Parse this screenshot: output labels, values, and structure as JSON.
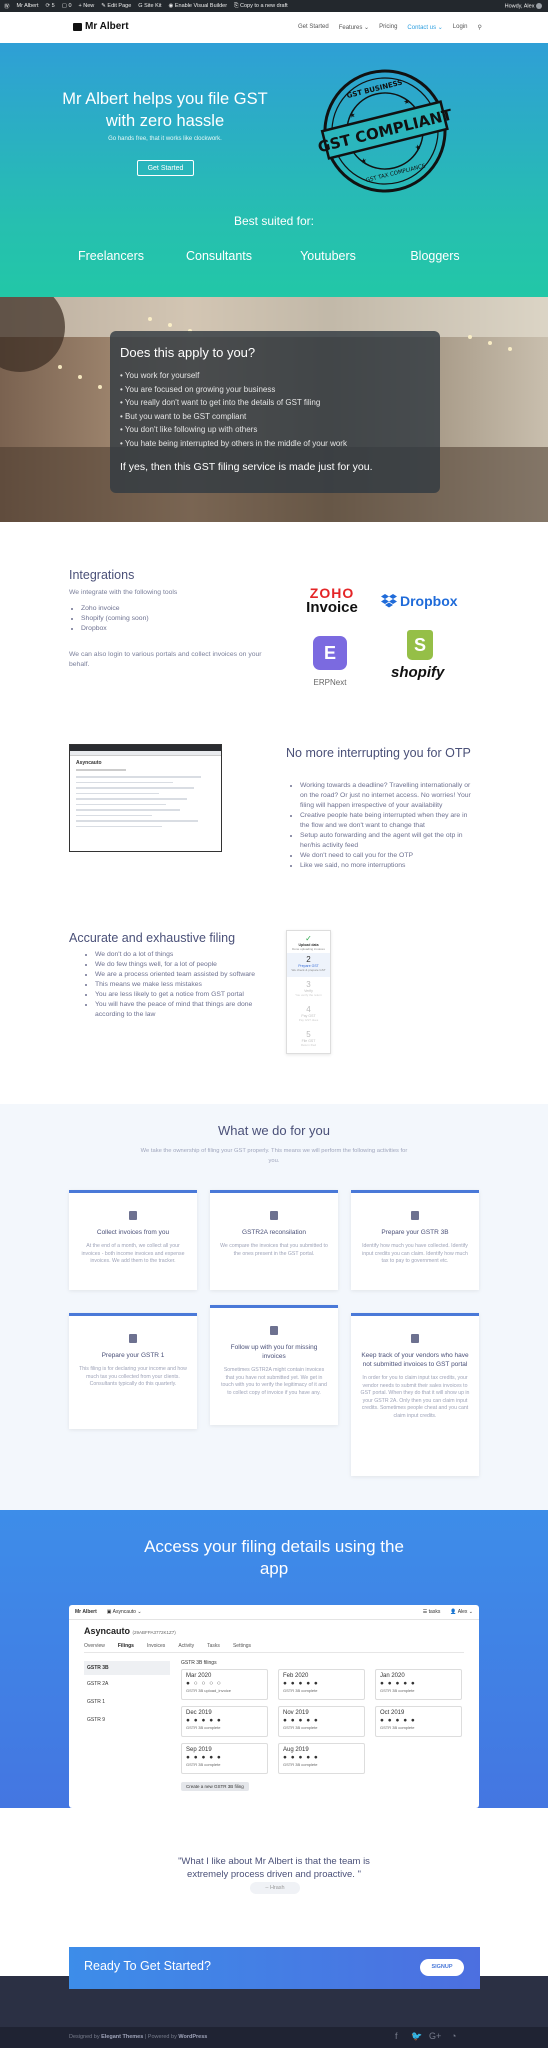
{
  "adminbar": {
    "site": "Mr Albert",
    "counts": "5",
    "comments": "0",
    "new": "+ New",
    "edit": "Edit Page",
    "siteKit": "Site Kit",
    "builder": "Enable Visual Builder",
    "copy": "Copy to a new draft",
    "howdy": "Howdy, Alex"
  },
  "header": {
    "logo": "Mr Albert",
    "nav": [
      "Get Started",
      "Features ⌄",
      "Pricing",
      "Contact us ⌄",
      "Login"
    ]
  },
  "hero": {
    "title": "Mr Albert helps you file GST with zero hassle",
    "subtitle": "Go hands free, that it works like clockwork.",
    "button": "Get Started",
    "stamp_top": "GST BUSINESS",
    "stamp_main": "GST COMPLIANT",
    "stamp_bottom": "GST TAX COMPLIANCE",
    "suited_title": "Best suited for:",
    "suited": [
      "Freelancers",
      "Consultants",
      "Youtubers",
      "Bloggers"
    ]
  },
  "apply": {
    "title": "Does this apply to you?",
    "items": [
      "You work for yourself",
      "You are focused on growing your business",
      "You really don't want to get into the details of GST filing",
      "But you want to be GST compliant",
      "You don't like following up with others",
      "You hate being interrupted by others in the middle of your work"
    ],
    "footer": "If yes, then this GST filing service is made just for you."
  },
  "integrations": {
    "title": "Integrations",
    "intro": "We integrate with the following tools",
    "items": [
      "Zoho invoice",
      "Shopify (coming soon)",
      "Dropbox"
    ],
    "note": "We can also login to various portals and collect invoices on your behalf.",
    "logos": {
      "zoho": "ZOHO",
      "zoho_sub": "Invoice",
      "dropbox": "Dropbox",
      "erpnext": "ERPNext",
      "erp_letter": "E",
      "shopify": "shopify"
    }
  },
  "otp": {
    "title": "No more interrupting you for OTP",
    "items": [
      "Working towards a deadline? Travelling internationally or on the road? Or just no internet access. No worries! Your filing will happen irrespective of your availability",
      "Creative people hate being interrupted when they are in the flow and we don't want to change that",
      "Setup auto forwarding and the agent will get the otp in her/his activity feed",
      "We don't need to call you for the OTP",
      "Like we said, no more interruptions"
    ],
    "shot_title": "Asyncauto"
  },
  "accurate": {
    "title": "Accurate and exhaustive filing",
    "items": [
      "We don't do a lot of things",
      "We do few things well, for a lot of people",
      "We are a process oriented team assisted by software",
      "This means we make less mistakes",
      "You are less likely to get a notice from GST portal",
      "You will have the peace of mind that things are done according to the law"
    ],
    "steps": [
      {
        "n": "✓",
        "t": "Upload data",
        "s": "Done uploading invoices"
      },
      {
        "n": "2",
        "t": "Prepare GST",
        "s": "We check & prepare GST"
      },
      {
        "n": "3",
        "t": "Verify",
        "s": "You verify the return"
      },
      {
        "n": "4",
        "t": "Pay GST",
        "s": "Pay GST dues"
      },
      {
        "n": "5",
        "t": "File GST",
        "s": "Return filed"
      }
    ]
  },
  "whatwedo": {
    "title": "What we do for you",
    "subtitle": "We take the ownership of filing your GST properly. This means we will perform the following activities for you.",
    "cards": [
      {
        "title": "Collect invoices from you",
        "body": "At the end of a month, we collect all your invoices - both income invoices and expense invoices. We add them to the tracker."
      },
      {
        "title": "GSTR2A reconsilation",
        "body": "We compare the invoices that you submitted to the ones present in the GST portal."
      },
      {
        "title": "Prepare your GSTR 3B",
        "body": "Identify how much you have collected. Identify input credits you can claim. Identify how much tax to pay to government etc."
      },
      {
        "title": "Prepare your GSTR 1",
        "body": "This filing is for declaring your income and how much tax you collected from your clients. Consultants typically do this quarterly."
      },
      {
        "title": "Follow up with you for missing invoices",
        "body": "Sometimes GSTR2A might contain invoices that you have not submitted yet. We get in touch with you to verify the legitimacy of it and to collect copy of invoice if you have any."
      },
      {
        "title": "Keep track of your vendors who have not submitted invoices to GST portal",
        "body": "In order for you to claim input tax credits, your vendor needs to submit their sales invoices to GST portal. When they do that it will show up in your GSTR 2A. Only then you can claim input credits. Sometimes people cheat and you cant claim input credits."
      }
    ]
  },
  "access": {
    "title": "Access your filing details using the app",
    "app": {
      "brand": "Mr Albert",
      "org": "Asyncauto ⌄",
      "tasks": "tasks",
      "user": "Alex ⌄",
      "company": "Asyncauto",
      "gstin": "(29ABFPA3772K1Z7)",
      "tabs": [
        "Overview",
        "Filings",
        "Invoices",
        "Activity",
        "Tasks",
        "Settings"
      ],
      "side": [
        "GSTR 3B",
        "GSTR 2A",
        "GSTR 1",
        "GSTR 9"
      ],
      "list_title": "GSTR 3B filings",
      "filings": [
        {
          "m": "Mar 2020",
          "d": "● ○ ○ ○ ○",
          "s": "GSTR 3B upload_invoice"
        },
        {
          "m": "Feb 2020",
          "d": "● ● ● ● ●",
          "s": "GSTR 3B complete"
        },
        {
          "m": "Jan 2020",
          "d": "● ● ● ● ●",
          "s": "GSTR 3B complete"
        },
        {
          "m": "Dec 2019",
          "d": "● ● ● ● ●",
          "s": "GSTR 3B complete"
        },
        {
          "m": "Nov 2019",
          "d": "● ● ● ● ●",
          "s": "GSTR 3B complete"
        },
        {
          "m": "Oct 2019",
          "d": "● ● ● ● ●",
          "s": "GSTR 3B complete"
        },
        {
          "m": "Sep 2019",
          "d": "● ● ● ● ●",
          "s": "GSTR 3B complete"
        },
        {
          "m": "Aug 2019",
          "d": "● ● ● ● ●",
          "s": "GSTR 3B complete"
        }
      ],
      "create": "Create a new GSTR 3B filing"
    }
  },
  "testimonial": {
    "quote": "\"What I like about Mr Albert is that the team is extremely process driven and proactive. \"",
    "who": "– Hrash"
  },
  "cta": {
    "title": "Ready To Get Started?",
    "button": "SIGNUP"
  },
  "footer": {
    "designed": "Designed by",
    "theme": "Elegant Themes",
    "powered": "| Powered by",
    "wp": "WordPress"
  },
  "colors": {
    "hero_top": "#2f9fd6",
    "hero_bottom": "#22c7a7",
    "accent": "#4a79d8",
    "heading": "#4a5078"
  }
}
